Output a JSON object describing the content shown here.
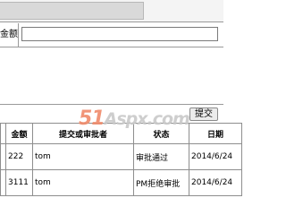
{
  "form": {
    "amount_label": "金额",
    "amount_value": "",
    "submit_label": "提交"
  },
  "watermark": {
    "brand_numeric": "51",
    "brand_text": "Aspx.com"
  },
  "table": {
    "headers": [
      "",
      "金额",
      "提交或审批者",
      "状态",
      "日期"
    ],
    "rows": [
      {
        "index": "",
        "amount": "222",
        "submitter": "tom",
        "status": "审批通过",
        "date": "2014/6/24"
      },
      {
        "index": "",
        "amount": "3111",
        "submitter": "tom",
        "status": "PM拒绝审批",
        "date": "2014/6/24"
      }
    ]
  }
}
